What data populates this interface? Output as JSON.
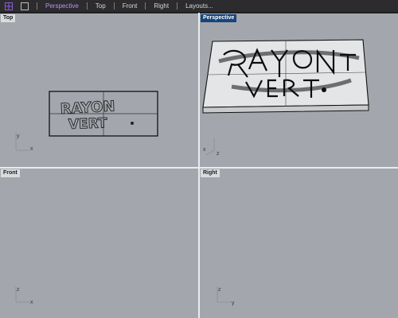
{
  "tabs": [
    {
      "label": "Perspective",
      "active": true
    },
    {
      "label": "Top",
      "active": false
    },
    {
      "label": "Front",
      "active": false
    },
    {
      "label": "Right",
      "active": false
    },
    {
      "label": "Layouts...",
      "active": false
    }
  ],
  "viewports": {
    "top": {
      "label": "Top",
      "axes": [
        "y",
        "x"
      ]
    },
    "perspective": {
      "label": "Perspective",
      "axes": [
        "x",
        "z"
      ]
    },
    "front": {
      "label": "Front",
      "axes": [
        "z",
        "x"
      ]
    },
    "right": {
      "label": "Right",
      "axes": [
        "z",
        "y"
      ]
    }
  },
  "model_text": {
    "line1": "RAYON",
    "line2": "VERT"
  },
  "colors": {
    "viewport_bg": "#a3a7ad",
    "active_tab": "#c58cf2",
    "active_label_bg": "#16457a"
  }
}
